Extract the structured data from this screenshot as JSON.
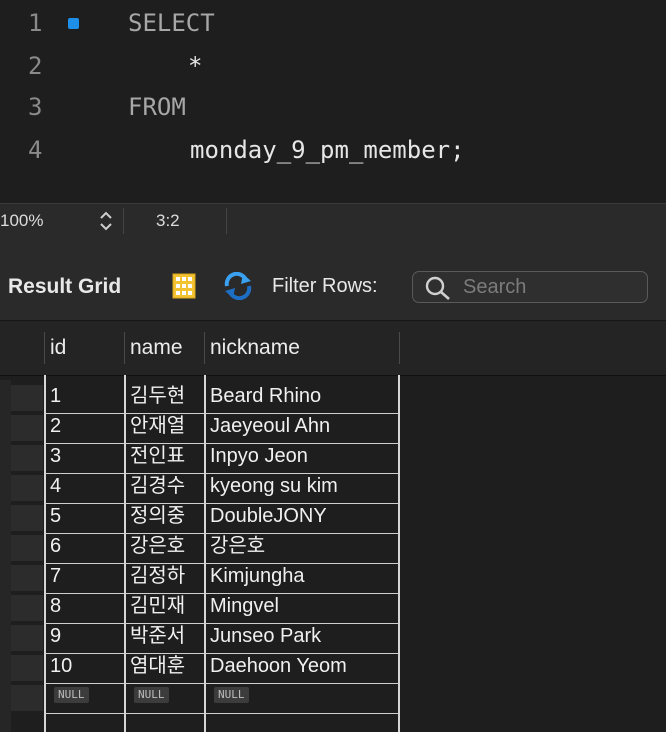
{
  "editor": {
    "lines": [
      {
        "number": "1",
        "keyword": "SELECT",
        "text": ""
      },
      {
        "number": "2",
        "keyword": "",
        "text": "*"
      },
      {
        "number": "3",
        "keyword": "FROM",
        "text": ""
      },
      {
        "number": "4",
        "keyword": "",
        "text": "monday_9_pm_member;"
      }
    ]
  },
  "status": {
    "zoom": "100%",
    "cursor": "3:2"
  },
  "toolbar": {
    "title": "Result Grid",
    "filter_label": "Filter Rows:",
    "search_placeholder": "Search"
  },
  "grid": {
    "columns": [
      "id",
      "name",
      "nickname"
    ],
    "rows": [
      {
        "id": "1",
        "name": "김두현",
        "nickname": "Beard Rhino"
      },
      {
        "id": "2",
        "name": "안재열",
        "nickname": "Jaeyeoul Ahn"
      },
      {
        "id": "3",
        "name": "전인표",
        "nickname": "Inpyo Jeon"
      },
      {
        "id": "4",
        "name": "김경수",
        "nickname": "kyeong su kim"
      },
      {
        "id": "5",
        "name": "정의중",
        "nickname": "DoubleJONY"
      },
      {
        "id": "6",
        "name": "강은호",
        "nickname": "강은호"
      },
      {
        "id": "7",
        "name": "김정하",
        "nickname": "Kimjungha"
      },
      {
        "id": "8",
        "name": "김민재",
        "nickname": "Mingvel"
      },
      {
        "id": "9",
        "name": "박준서",
        "nickname": "Junseo Park"
      },
      {
        "id": "10",
        "name": "염대훈",
        "nickname": "Daehoon Yeom"
      }
    ],
    "null_label": "NULL"
  }
}
